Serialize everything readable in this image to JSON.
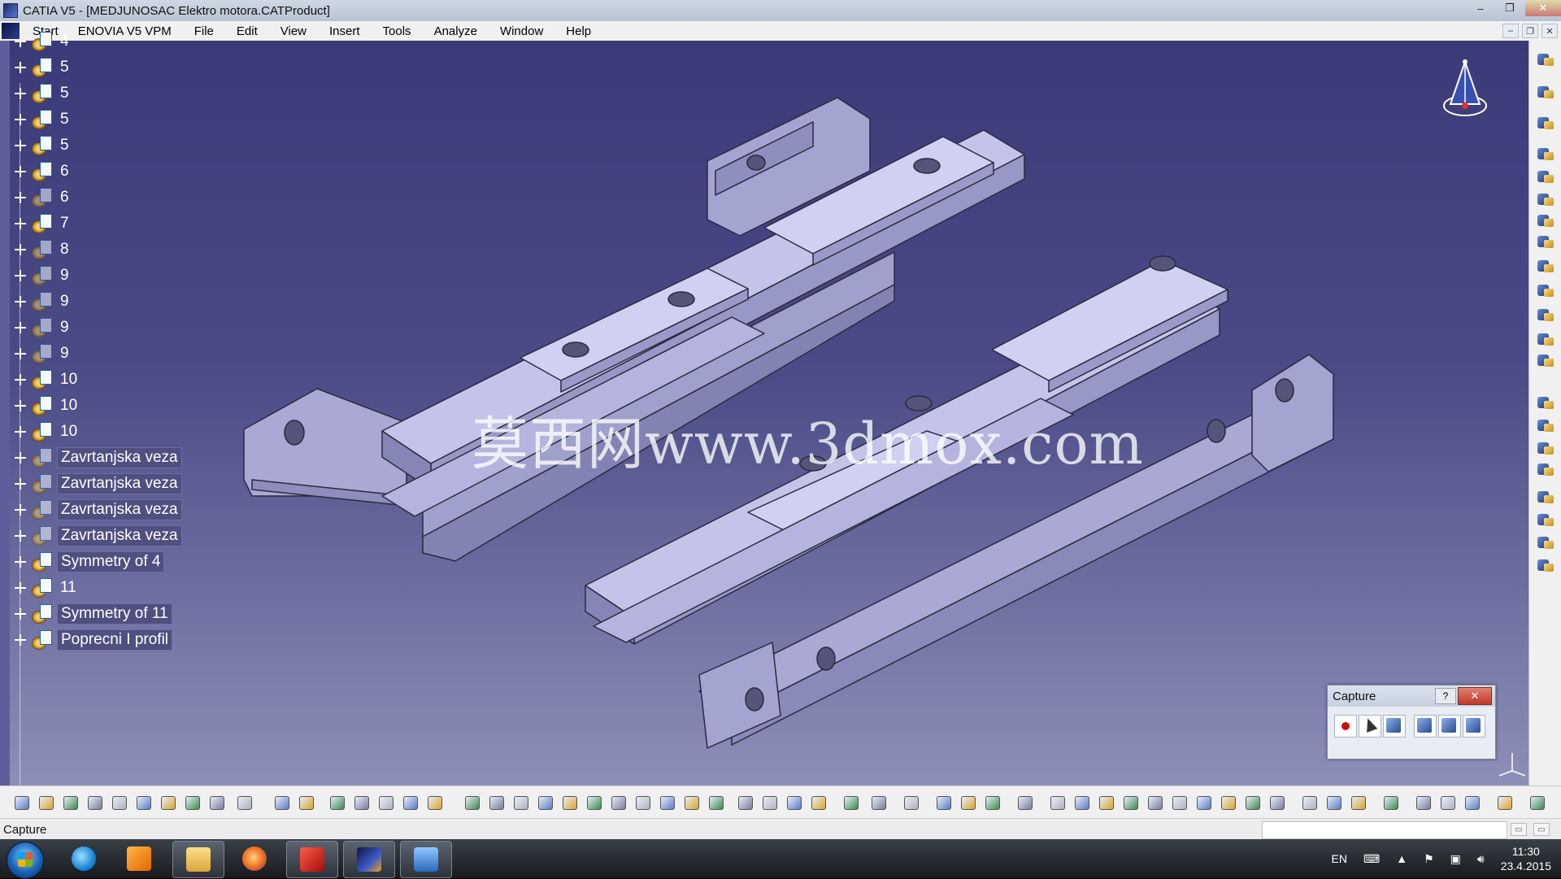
{
  "window": {
    "title": "CATIA V5 - [MEDJUNOSAC Elektro motora.CATProduct]",
    "controls": [
      "–",
      "❐",
      "✕"
    ]
  },
  "menu": {
    "items": [
      "Start",
      "ENOVIA V5 VPM",
      "File",
      "Edit",
      "View",
      "Insert",
      "Tools",
      "Analyze",
      "Window",
      "Help"
    ],
    "mdi_controls": [
      "–",
      "❐",
      "✕"
    ]
  },
  "tree": {
    "items": [
      {
        "label": "4",
        "hidden": false
      },
      {
        "label": "5",
        "hidden": false
      },
      {
        "label": "5",
        "hidden": false
      },
      {
        "label": "5",
        "hidden": false
      },
      {
        "label": "5",
        "hidden": false
      },
      {
        "label": "6",
        "hidden": false
      },
      {
        "label": "6",
        "hidden": true
      },
      {
        "label": "7",
        "hidden": false
      },
      {
        "label": "8",
        "hidden": true
      },
      {
        "label": "9",
        "hidden": true
      },
      {
        "label": "9",
        "hidden": true
      },
      {
        "label": "9",
        "hidden": true
      },
      {
        "label": "9",
        "hidden": true
      },
      {
        "label": "10",
        "hidden": false
      },
      {
        "label": "10",
        "hidden": false
      },
      {
        "label": "10",
        "hidden": false
      },
      {
        "label": "Zavrtanjska veza",
        "hidden": true
      },
      {
        "label": "Zavrtanjska veza",
        "hidden": true
      },
      {
        "label": "Zavrtanjska veza",
        "hidden": true
      },
      {
        "label": "Zavrtanjska veza",
        "hidden": true
      },
      {
        "label": "Symmetry of 4",
        "hidden": false
      },
      {
        "label": "11",
        "hidden": false
      },
      {
        "label": "Symmetry of 11",
        "hidden": false
      },
      {
        "label": "Poprecni I profil",
        "hidden": false
      }
    ]
  },
  "watermark": "莫西网www.3dmox.com",
  "capture_dialog": {
    "title": "Capture",
    "help": "?",
    "close": "✕",
    "tools": [
      "record-icon",
      "select-icon",
      "options-icon",
      "capture-screen-icon",
      "album-icon",
      "graph-icon"
    ]
  },
  "status": {
    "text": "Capture"
  },
  "taskbar": {
    "apps": [
      "internet-explorer-icon",
      "media-player-icon",
      "file-explorer-icon",
      "firefox-icon",
      "acrobat-icon",
      "catia-icon",
      "photos-icon"
    ],
    "language": "EN",
    "time": "11:30",
    "date": "23.4.2015"
  },
  "colors": {
    "viewport_top": "#3a3a78",
    "viewport_bottom": "#8d8fb8",
    "part_face": "#b3b3dd",
    "part_top": "#c6c6ec",
    "part_edge": "#2a2a40"
  }
}
